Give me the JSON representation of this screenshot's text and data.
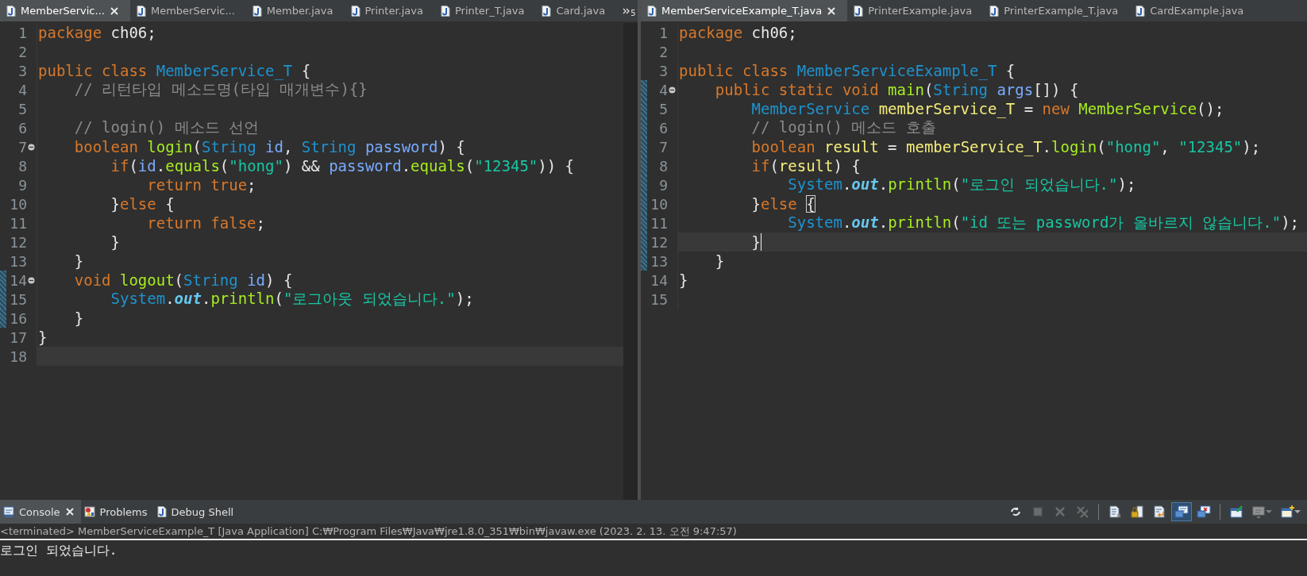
{
  "editors": [
    {
      "active": false,
      "overflow_count": "5",
      "tabs": [
        {
          "label": "MemberServic...",
          "selected": true
        },
        {
          "label": "MemberServic...",
          "selected": false
        },
        {
          "label": "Member.java",
          "selected": false
        },
        {
          "label": "Printer.java",
          "selected": false
        },
        {
          "label": "Printer_T.java",
          "selected": false
        },
        {
          "label": "Card.java",
          "selected": false
        }
      ],
      "lines": [
        {
          "number": "1",
          "changed": false,
          "fold": false,
          "current": false,
          "tokens": [
            {
              "kind": "kw",
              "text": "package"
            },
            {
              "kind": "plain",
              "text": " ch06;"
            }
          ]
        },
        {
          "number": "2",
          "changed": false,
          "fold": false,
          "current": false
        },
        {
          "number": "3",
          "changed": false,
          "fold": false,
          "current": false,
          "tokens": [
            {
              "kind": "kw",
              "text": "public class "
            },
            {
              "kind": "type",
              "text": "MemberService_T"
            },
            {
              "kind": "plain",
              "text": " {"
            }
          ]
        },
        {
          "number": "4",
          "changed": false,
          "fold": false,
          "current": false,
          "tokens": [
            {
              "kind": "cmt",
              "text": "    // 리턴타입 메소드명(타입 매개변수){}"
            }
          ]
        },
        {
          "number": "5",
          "changed": false,
          "fold": false,
          "current": false
        },
        {
          "number": "6",
          "changed": false,
          "fold": false,
          "current": false,
          "tokens": [
            {
              "kind": "cmt",
              "text": "    // login() 메소드 선언"
            }
          ]
        },
        {
          "number": "7",
          "changed": false,
          "fold": true,
          "current": false,
          "tokens": [
            {
              "kind": "kw",
              "text": "    boolean "
            },
            {
              "kind": "method",
              "text": "login"
            },
            {
              "kind": "plain",
              "text": "("
            },
            {
              "kind": "type",
              "text": "String "
            },
            {
              "kind": "param",
              "text": "id"
            },
            {
              "kind": "plain",
              "text": ", "
            },
            {
              "kind": "type",
              "text": "String "
            },
            {
              "kind": "param",
              "text": "password"
            },
            {
              "kind": "plain",
              "text": ") {"
            }
          ]
        },
        {
          "number": "8",
          "changed": false,
          "fold": false,
          "current": false,
          "tokens": [
            {
              "kind": "kw",
              "text": "        if"
            },
            {
              "kind": "plain",
              "text": "("
            },
            {
              "kind": "param",
              "text": "id"
            },
            {
              "kind": "plain",
              "text": "."
            },
            {
              "kind": "method",
              "text": "equals"
            },
            {
              "kind": "plain",
              "text": "("
            },
            {
              "kind": "str",
              "text": "\"hong\""
            },
            {
              "kind": "plain",
              "text": ") && "
            },
            {
              "kind": "param",
              "text": "password"
            },
            {
              "kind": "plain",
              "text": "."
            },
            {
              "kind": "method",
              "text": "equals"
            },
            {
              "kind": "plain",
              "text": "("
            },
            {
              "kind": "str",
              "text": "\"12345\""
            },
            {
              "kind": "plain",
              "text": ")) {"
            }
          ]
        },
        {
          "number": "9",
          "changed": false,
          "fold": false,
          "current": false,
          "tokens": [
            {
              "kind": "kw",
              "text": "            return true"
            },
            {
              "kind": "plain",
              "text": ";"
            }
          ]
        },
        {
          "number": "10",
          "changed": false,
          "fold": false,
          "current": false,
          "tokens": [
            {
              "kind": "plain",
              "text": "        }"
            },
            {
              "kind": "kw",
              "text": "else"
            },
            {
              "kind": "plain",
              "text": " {"
            }
          ]
        },
        {
          "number": "11",
          "changed": false,
          "fold": false,
          "current": false,
          "tokens": [
            {
              "kind": "kw",
              "text": "            return false"
            },
            {
              "kind": "plain",
              "text": ";"
            }
          ]
        },
        {
          "number": "12",
          "changed": false,
          "fold": false,
          "current": false,
          "tokens": [
            {
              "kind": "plain",
              "text": "        }"
            }
          ]
        },
        {
          "number": "13",
          "changed": false,
          "fold": false,
          "current": false,
          "tokens": [
            {
              "kind": "plain",
              "text": "    }"
            }
          ]
        },
        {
          "number": "14",
          "changed": true,
          "fold": true,
          "current": false,
          "tokens": [
            {
              "kind": "kw",
              "text": "    void "
            },
            {
              "kind": "method",
              "text": "logout"
            },
            {
              "kind": "plain",
              "text": "("
            },
            {
              "kind": "type",
              "text": "String "
            },
            {
              "kind": "param",
              "text": "id"
            },
            {
              "kind": "plain",
              "text": ") {"
            }
          ]
        },
        {
          "number": "15",
          "changed": true,
          "fold": false,
          "current": false,
          "tokens": [
            {
              "kind": "type",
              "text": "        System"
            },
            {
              "kind": "plain",
              "text": "."
            },
            {
              "kind": "field",
              "text": "out"
            },
            {
              "kind": "plain",
              "text": "."
            },
            {
              "kind": "method",
              "text": "println"
            },
            {
              "kind": "plain",
              "text": "("
            },
            {
              "kind": "str",
              "text": "\"로그아웃 되었습니다.\""
            },
            {
              "kind": "plain",
              "text": ");"
            }
          ]
        },
        {
          "number": "16",
          "changed": true,
          "fold": false,
          "current": false,
          "tokens": [
            {
              "kind": "plain",
              "text": "    }"
            }
          ]
        },
        {
          "number": "17",
          "changed": false,
          "fold": false,
          "current": false,
          "tokens": [
            {
              "kind": "plain",
              "text": "}"
            }
          ]
        },
        {
          "number": "18",
          "changed": false,
          "fold": false,
          "current": true
        }
      ]
    },
    {
      "active": true,
      "tabs": [
        {
          "label": "MemberServiceExample_T.java",
          "selected": true
        },
        {
          "label": "PrinterExample.java",
          "selected": false
        },
        {
          "label": "PrinterExample_T.java",
          "selected": false
        },
        {
          "label": "CardExample.java",
          "selected": false
        }
      ],
      "lines": [
        {
          "number": "1",
          "changed": false,
          "fold": false,
          "current": false,
          "tokens": [
            {
              "kind": "kw",
              "text": "package"
            },
            {
              "kind": "plain",
              "text": " ch06;"
            }
          ]
        },
        {
          "number": "2",
          "changed": false,
          "fold": false,
          "current": false
        },
        {
          "number": "3",
          "changed": false,
          "fold": false,
          "current": false,
          "tokens": [
            {
              "kind": "kw",
              "text": "public class "
            },
            {
              "kind": "type",
              "text": "MemberServiceExample_T"
            },
            {
              "kind": "plain",
              "text": " {"
            }
          ]
        },
        {
          "number": "4",
          "changed": true,
          "fold": true,
          "current": false,
          "tokens": [
            {
              "kind": "kw",
              "text": "    public static void "
            },
            {
              "kind": "method",
              "text": "main"
            },
            {
              "kind": "plain",
              "text": "("
            },
            {
              "kind": "type",
              "text": "String "
            },
            {
              "kind": "param",
              "text": "args"
            },
            {
              "kind": "plain",
              "text": "[]) {"
            }
          ]
        },
        {
          "number": "5",
          "changed": true,
          "fold": false,
          "current": false,
          "tokens": [
            {
              "kind": "type",
              "text": "        MemberService "
            },
            {
              "kind": "local",
              "text": "memberService_T"
            },
            {
              "kind": "plain",
              "text": " = "
            },
            {
              "kind": "kw",
              "text": "new "
            },
            {
              "kind": "method",
              "text": "MemberService"
            },
            {
              "kind": "plain",
              "text": "();"
            }
          ]
        },
        {
          "number": "6",
          "changed": true,
          "fold": false,
          "current": false,
          "tokens": [
            {
              "kind": "cmt",
              "text": "        // login() 메소드 호출"
            }
          ]
        },
        {
          "number": "7",
          "changed": true,
          "fold": false,
          "current": false,
          "tokens": [
            {
              "kind": "kw",
              "text": "        boolean "
            },
            {
              "kind": "local",
              "text": "result"
            },
            {
              "kind": "plain",
              "text": " = "
            },
            {
              "kind": "local",
              "text": "memberService_T"
            },
            {
              "kind": "plain",
              "text": "."
            },
            {
              "kind": "method",
              "text": "login"
            },
            {
              "kind": "plain",
              "text": "("
            },
            {
              "kind": "str",
              "text": "\"hong\""
            },
            {
              "kind": "plain",
              "text": ", "
            },
            {
              "kind": "str",
              "text": "\"12345\""
            },
            {
              "kind": "plain",
              "text": ");"
            }
          ]
        },
        {
          "number": "8",
          "changed": true,
          "fold": false,
          "current": false,
          "tokens": [
            {
              "kind": "kw",
              "text": "        if"
            },
            {
              "kind": "plain",
              "text": "("
            },
            {
              "kind": "local",
              "text": "result"
            },
            {
              "kind": "plain",
              "text": ") {"
            }
          ]
        },
        {
          "number": "9",
          "changed": true,
          "fold": false,
          "current": false,
          "tokens": [
            {
              "kind": "type",
              "text": "            System"
            },
            {
              "kind": "plain",
              "text": "."
            },
            {
              "kind": "field",
              "text": "out"
            },
            {
              "kind": "plain",
              "text": "."
            },
            {
              "kind": "method",
              "text": "println"
            },
            {
              "kind": "plain",
              "text": "("
            },
            {
              "kind": "str",
              "text": "\"로그인 되었습니다.\""
            },
            {
              "kind": "plain",
              "text": ");"
            }
          ]
        },
        {
          "number": "10",
          "changed": true,
          "fold": false,
          "current": false,
          "tokens": [
            {
              "kind": "plain",
              "text": "        }"
            },
            {
              "kind": "kw",
              "text": "else "
            },
            {
              "kind": "match",
              "text": "{"
            }
          ]
        },
        {
          "number": "11",
          "changed": true,
          "fold": false,
          "current": false,
          "tokens": [
            {
              "kind": "type",
              "text": "            System"
            },
            {
              "kind": "plain",
              "text": "."
            },
            {
              "kind": "field",
              "text": "out"
            },
            {
              "kind": "plain",
              "text": "."
            },
            {
              "kind": "method",
              "text": "println"
            },
            {
              "kind": "plain",
              "text": "("
            },
            {
              "kind": "str",
              "text": "\"id 또는 password가 올바르지 않습니다.\""
            },
            {
              "kind": "plain",
              "text": ");"
            }
          ]
        },
        {
          "number": "12",
          "changed": true,
          "fold": false,
          "current": true,
          "tokens": [
            {
              "kind": "plain",
              "text": "        }"
            }
          ]
        },
        {
          "number": "13",
          "changed": true,
          "fold": false,
          "current": false,
          "tokens": [
            {
              "kind": "plain",
              "text": "    }"
            }
          ]
        },
        {
          "number": "14",
          "changed": false,
          "fold": false,
          "current": false,
          "tokens": [
            {
              "kind": "plain",
              "text": "}"
            }
          ]
        },
        {
          "number": "15",
          "changed": false,
          "fold": false,
          "current": false
        }
      ]
    }
  ],
  "console": {
    "tabs": [
      {
        "label": "Console",
        "kind": "console",
        "selected": true
      },
      {
        "label": "Problems",
        "kind": "problems",
        "selected": false
      },
      {
        "label": "Debug Shell",
        "kind": "debug",
        "selected": false
      }
    ],
    "toolbar_groups": [
      {
        "buttons": [
          {
            "kind": "relaunch",
            "selected": false,
            "disabled": false,
            "dropdown": false
          },
          {
            "kind": "terminate",
            "selected": false,
            "disabled": true,
            "dropdown": false
          },
          {
            "kind": "remove",
            "selected": false,
            "disabled": true,
            "dropdown": false
          },
          {
            "kind": "remove-all",
            "selected": false,
            "disabled": true,
            "dropdown": false
          }
        ]
      },
      {
        "buttons": [
          {
            "kind": "clear",
            "selected": false,
            "disabled": false,
            "dropdown": false
          },
          {
            "kind": "scroll-lock",
            "selected": false,
            "disabled": false,
            "dropdown": false
          },
          {
            "kind": "word-wrap",
            "selected": false,
            "disabled": false,
            "dropdown": false
          },
          {
            "kind": "stdout",
            "selected": true,
            "disabled": false,
            "dropdown": false
          },
          {
            "kind": "stderr",
            "selected": false,
            "disabled": false,
            "dropdown": false
          }
        ]
      },
      {
        "buttons": [
          {
            "kind": "pin",
            "selected": false,
            "disabled": false,
            "dropdown": false
          },
          {
            "kind": "display",
            "selected": false,
            "disabled": true,
            "dropdown": true
          },
          {
            "kind": "new-console",
            "selected": false,
            "disabled": false,
            "dropdown": true
          }
        ]
      }
    ],
    "status": "<terminated> MemberServiceExample_T [Java Application] C:₩Program Files₩Java₩jre1.8.0_351₩bin₩javaw.exe (2023. 2. 13. 오전 9:47:57)",
    "output": "로그인 되었습니다."
  }
}
